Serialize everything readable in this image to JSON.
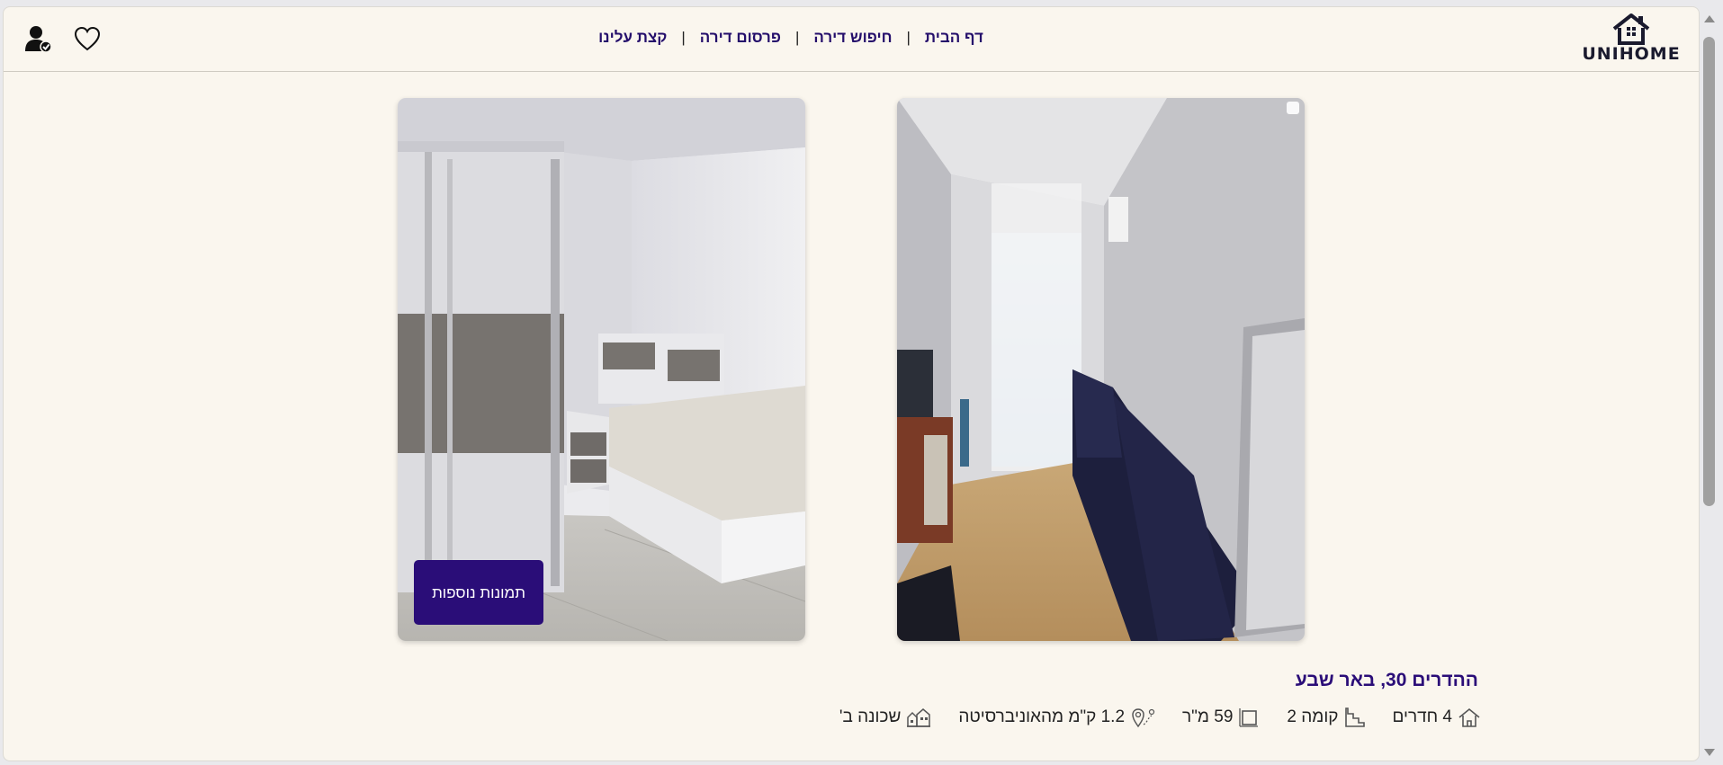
{
  "header": {
    "logo_text": "UNIHOME",
    "nav": [
      {
        "label": "דף הבית"
      },
      {
        "label": "חיפוש דירה"
      },
      {
        "label": "פרסום דירה"
      },
      {
        "label": "קצת עלינו"
      }
    ],
    "separator": "|"
  },
  "gallery": {
    "more_photos_label": "תמונות נוספות"
  },
  "listing": {
    "address": "ההדרים 30, באר שבע",
    "features": [
      {
        "icon": "home-icon",
        "text": "4 חדרים"
      },
      {
        "icon": "stairs-icon",
        "text": "קומה 2"
      },
      {
        "icon": "area-icon",
        "text": "59 מ\"ר"
      },
      {
        "icon": "location-pin-icon",
        "text": "1.2 ק\"מ מהאוניברסיטה"
      },
      {
        "icon": "neighborhood-icon",
        "text": "שכונה ב'"
      }
    ]
  },
  "colors": {
    "background": "#faf6ee",
    "accent": "#2a0d78"
  }
}
